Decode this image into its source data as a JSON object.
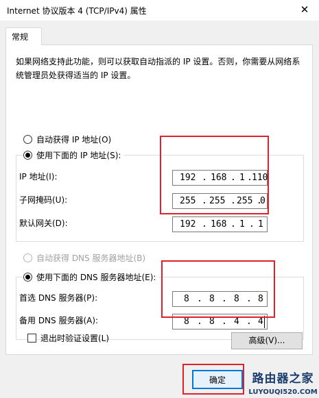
{
  "window": {
    "title": "Internet 协议版本 4 (TCP/IPv4) 属性",
    "close_glyph": "✕"
  },
  "tabs": [
    {
      "label": "常规"
    }
  ],
  "description": "如果网络支持此功能，则可以获取自动指派的 IP 设置。否则，你需要从网络系统管理员处获得适当的 IP 设置。",
  "ip_section": {
    "auto_option": "自动获得 IP 地址(O)",
    "manual_option": "使用下面的 IP 地址(S):",
    "selected": "manual",
    "fields": [
      {
        "label": "IP 地址(I):",
        "octets": [
          "192",
          "168",
          "1",
          "110"
        ]
      },
      {
        "label": "子网掩码(U):",
        "octets": [
          "255",
          "255",
          "255",
          "0"
        ]
      },
      {
        "label": "默认网关(D):",
        "octets": [
          "192",
          "168",
          "1",
          "1"
        ]
      }
    ]
  },
  "dns_section": {
    "auto_option": "自动获得 DNS 服务器地址(B)",
    "manual_option": "使用下面的 DNS 服务器地址(E):",
    "selected": "manual",
    "fields": [
      {
        "label": "首选 DNS 服务器(P):",
        "octets": [
          "8",
          "8",
          "8",
          "8"
        ]
      },
      {
        "label": "备用 DNS 服务器(A):",
        "octets": [
          "8",
          "8",
          "4",
          "4"
        ]
      }
    ]
  },
  "validate_on_exit": {
    "label": "退出时验证设置(L)",
    "checked": false
  },
  "buttons": {
    "advanced": "高级(V)...",
    "ok": "确定"
  },
  "watermark": {
    "logo": "路由器之家",
    "url": "LUYOUQI520.COM"
  },
  "colors": {
    "highlight": "#e0202a",
    "accent": "#0078d7"
  },
  "dot": "."
}
